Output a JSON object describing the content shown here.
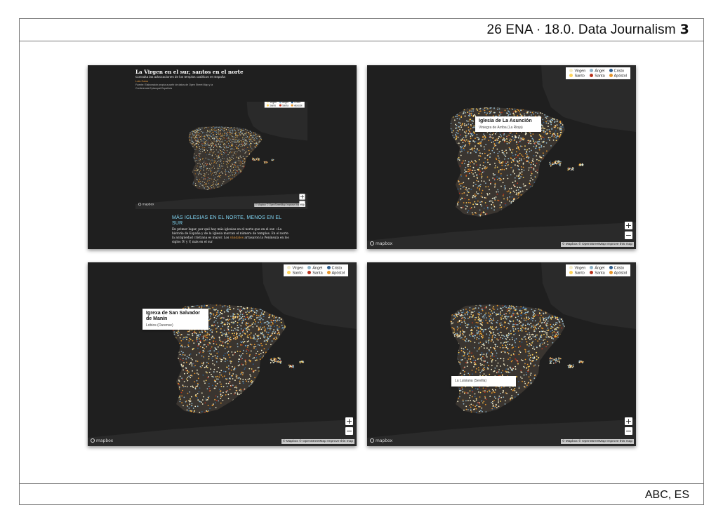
{
  "header": {
    "title": "26 ENA · 18.0. Data Journalism",
    "page_number": "3"
  },
  "footer": {
    "source": "ABC, ES"
  },
  "legend": {
    "items": [
      {
        "label": "Virgen",
        "color": "#f3ecc8"
      },
      {
        "label": "Ángel",
        "color": "#8fb4c8"
      },
      {
        "label": "Cristo",
        "color": "#2f5f8f"
      },
      {
        "label": "Santo",
        "color": "#ffd45a"
      },
      {
        "label": "Santa",
        "color": "#b8321c"
      },
      {
        "label": "Apóstol",
        "color": "#e8962a"
      }
    ]
  },
  "map": {
    "zoom_in": "+",
    "zoom_out": "−",
    "logo": "mapbox",
    "attribution": "© Mapbox © OpenStreetMap Improve this map",
    "land_color": "#2a2a2a",
    "water_color": "#1f1f1f"
  },
  "article": {
    "title": "La Virgen en el sur, santos en el norte",
    "subtitle": "Consulta las advocaciones de los templos católicos en España",
    "author": "Luis Cano",
    "note": "Fuente: Elaboración propia a partir de datos de Open Street Map y la Conferencia Episcopal Española",
    "heading": "MÁS IGLESIAS EN EL NORTE, MENOS EN EL SUR",
    "paragraph_1": "En primer lugar, por qué hay más iglesias en el norte que en el sur. «La historia de España y de la Iglesia marcan el número de templos. En el norte la antigüedad cristiana es mayor. Los",
    "highlight": "vándalos",
    "paragraph_2": " arrasaron la Península en los siglos IV y V, más en el sur"
  },
  "tooltips": {
    "shot2": {
      "title": "Iglesia de La Asunción",
      "subtitle": "Viniegra de Arriba (La Rioja)"
    },
    "shot3": {
      "title": "Igrexa de San Salvador de Manín",
      "subtitle": "Lobios (Ourense)"
    },
    "shot4": {
      "title": "",
      "subtitle": "La Luisiana (Sevilla)"
    }
  }
}
